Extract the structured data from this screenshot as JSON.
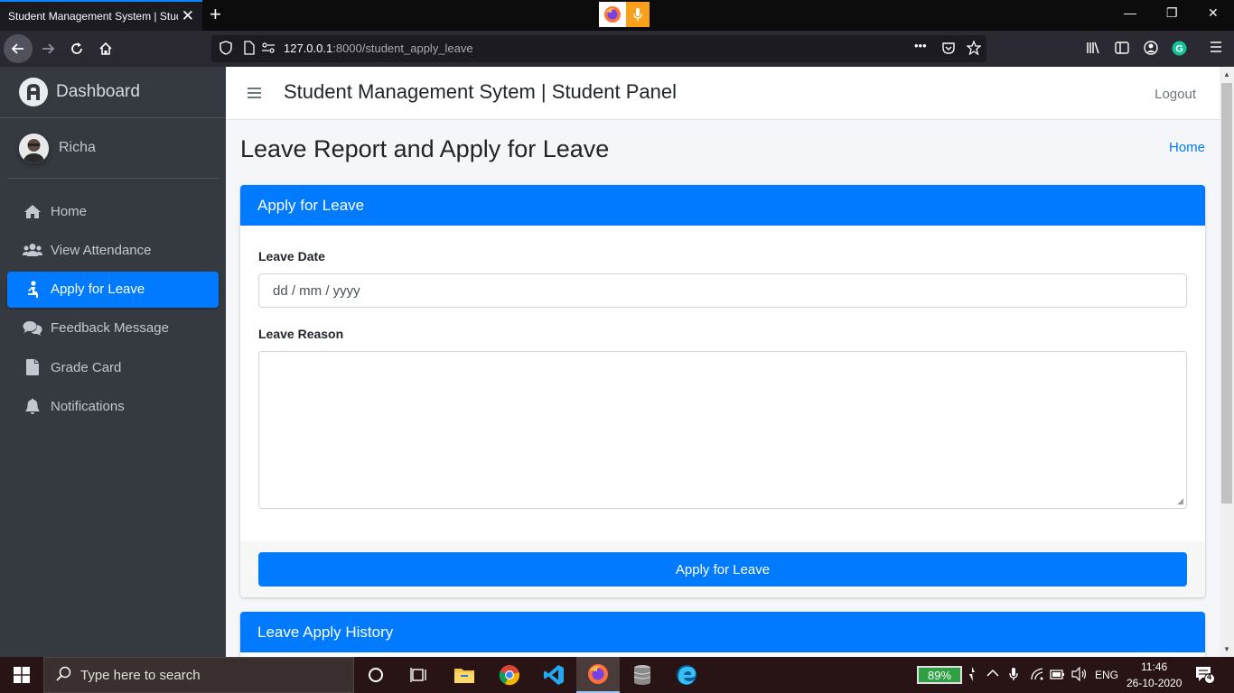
{
  "browser": {
    "tab_title": "Student Management System | Student Panel",
    "url_host": "127.0.0.1",
    "url_path": ":8000/student_apply_leave",
    "url_more": "•••"
  },
  "sidebar": {
    "brand": "Dashboard",
    "user_name": "Richa",
    "items": [
      {
        "label": "Home",
        "icon": "home-icon",
        "active": false
      },
      {
        "label": "View Attendance",
        "icon": "users-icon",
        "active": false
      },
      {
        "label": "Apply for Leave",
        "icon": "person-icon",
        "active": true
      },
      {
        "label": "Feedback Message",
        "icon": "comments-icon",
        "active": false
      },
      {
        "label": "Grade Card",
        "icon": "file-icon",
        "active": false
      },
      {
        "label": "Notifications",
        "icon": "bell-icon",
        "active": false
      }
    ]
  },
  "header": {
    "title": "Student Management Sytem | Student Panel",
    "logout": "Logout"
  },
  "page": {
    "title": "Leave Report and Apply for Leave",
    "breadcrumb": "Home"
  },
  "apply_card": {
    "title": "Apply for Leave",
    "date_label": "Leave Date",
    "date_placeholder": "dd / mm / yyyy",
    "reason_label": "Leave Reason",
    "submit_label": "Apply for Leave"
  },
  "history_card": {
    "title": "Leave Apply History"
  },
  "taskbar": {
    "search_placeholder": "Type here to search",
    "battery": "89%",
    "language": "ENG",
    "time": "11:46",
    "date": "26-10-2020",
    "notification_count": "4"
  },
  "colors": {
    "primary": "#007bff",
    "sidebar_bg": "#343a40",
    "content_bg": "#f4f6f9"
  }
}
